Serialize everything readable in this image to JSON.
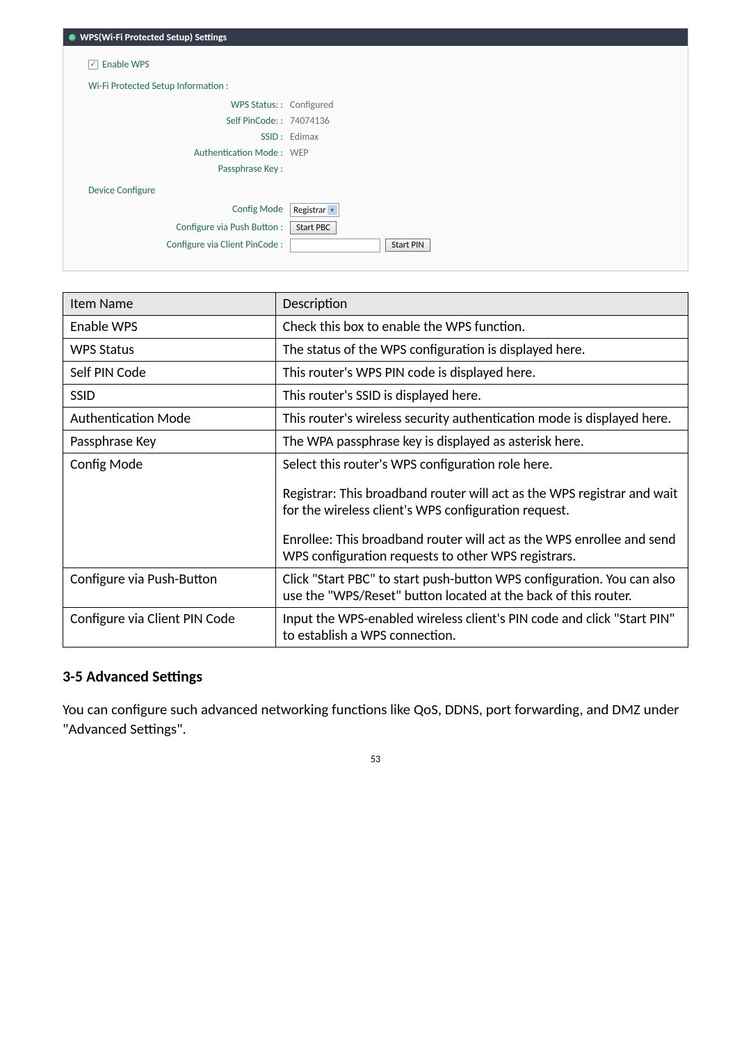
{
  "panel": {
    "title": "WPS(Wi-Fi Protected Setup) Settings",
    "enable_label": "Enable WPS",
    "info_heading": "Wi-Fi Protected Setup Information :",
    "rows": {
      "wps_status": {
        "label": "WPS Status: :",
        "value": "Configured"
      },
      "self_pin": {
        "label": "Self PinCode: :",
        "value": "74074136"
      },
      "ssid": {
        "label": "SSID :",
        "value": "Edimax"
      },
      "auth_mode": {
        "label": "Authentication Mode :",
        "value": "WEP"
      },
      "passphrase": {
        "label": "Passphrase Key :",
        "value": ""
      }
    },
    "device_configure": "Device Configure",
    "config_mode_label": "Config Mode",
    "config_mode_value": "Registrar",
    "push_button_label": "Configure via Push Button :",
    "push_button_btn": "Start PBC",
    "client_pin_label": "Configure via Client PinCode :",
    "client_pin_btn": "Start PIN"
  },
  "table": {
    "headers": [
      "Item Name",
      "Description"
    ],
    "rows": [
      {
        "name": "Enable WPS",
        "desc": [
          "Check this box to enable the WPS function."
        ]
      },
      {
        "name": "WPS Status",
        "desc": [
          "The status of the WPS configuration is displayed here."
        ]
      },
      {
        "name": "Self PIN Code",
        "desc": [
          "This router's WPS PIN code is displayed here."
        ]
      },
      {
        "name": "SSID",
        "desc": [
          "This router's SSID is displayed here."
        ]
      },
      {
        "name": "Authentication Mode",
        "desc": [
          "This router's wireless security authentication mode is displayed here."
        ]
      },
      {
        "name": "Passphrase Key",
        "desc": [
          "The WPA passphrase key is displayed as asterisk here."
        ]
      },
      {
        "name": "Config Mode",
        "desc": [
          "Select this router's WPS configuration role here.",
          "Registrar: This broadband router will act as the WPS registrar and wait for the wireless client's WPS configuration request.",
          "Enrollee: This broadband router will act as the WPS enrollee and send WPS configuration requests to other WPS registrars."
        ]
      },
      {
        "name": "Configure via Push-Button",
        "desc": [
          "Click \"Start PBC\" to start push-button WPS configuration. You can also use the \"WPS/Reset\" button located at the back of this router."
        ]
      },
      {
        "name": "Configure via Client PIN Code",
        "desc": [
          "Input the WPS-enabled wireless client's PIN code and click \"Start PIN\" to establish a WPS connection."
        ]
      }
    ]
  },
  "section_heading": "3-5 Advanced Settings",
  "body_text": "You can configure such advanced networking functions like QoS, DDNS, port forwarding, and DMZ under \"Advanced Settings\".",
  "page_number": "53"
}
